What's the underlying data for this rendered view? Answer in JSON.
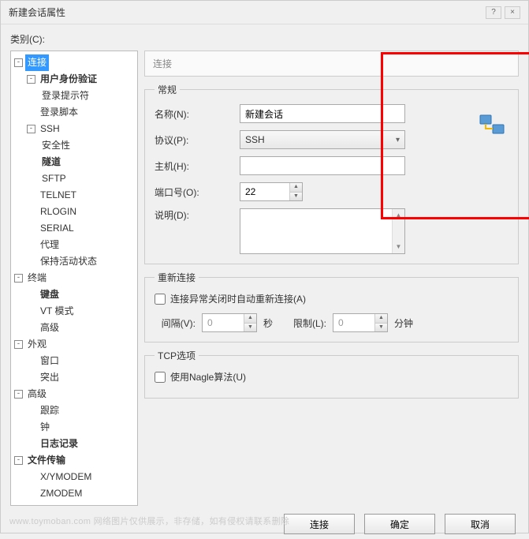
{
  "title": "新建会话属性",
  "category_label": "类别(C):",
  "tree": {
    "connection": {
      "label": "连接",
      "expanded": true,
      "selected": true
    },
    "userauth": {
      "label": "用户身份验证",
      "bold": true,
      "expanded": true
    },
    "loginprompt": {
      "label": "登录提示符"
    },
    "loginscript": {
      "label": "登录脚本"
    },
    "ssh": {
      "label": "SSH",
      "expanded": true
    },
    "security": {
      "label": "安全性"
    },
    "tunnel": {
      "label": "隧道",
      "bold": true
    },
    "sftp": {
      "label": "SFTP"
    },
    "telnet": {
      "label": "TELNET"
    },
    "rlogin": {
      "label": "RLOGIN"
    },
    "serial": {
      "label": "SERIAL"
    },
    "proxy": {
      "label": "代理"
    },
    "keepalive": {
      "label": "保持活动状态"
    },
    "terminal": {
      "label": "终端",
      "expanded": true
    },
    "keyboard": {
      "label": "键盘",
      "bold": true
    },
    "vtmode": {
      "label": "VT 模式"
    },
    "advanced_t": {
      "label": "高级"
    },
    "appearance": {
      "label": "外观",
      "expanded": true
    },
    "window": {
      "label": "窗口"
    },
    "highlight": {
      "label": "突出"
    },
    "advanced": {
      "label": "高级",
      "expanded": true
    },
    "trace": {
      "label": "跟踪"
    },
    "bell": {
      "label": "钟"
    },
    "logging": {
      "label": "日志记录",
      "bold": true
    },
    "filetransfer": {
      "label": "文件传输",
      "expanded": true
    },
    "xymodem": {
      "label": "X/YMODEM"
    },
    "zmodem": {
      "label": "ZMODEM"
    }
  },
  "header_title": "连接",
  "general": {
    "legend": "常规",
    "name_label": "名称(N):",
    "name_value": "新建会话",
    "protocol_label": "协议(P):",
    "protocol_value": "SSH",
    "host_label": "主机(H):",
    "host_value": "",
    "port_label": "端口号(O):",
    "port_value": "22",
    "desc_label": "说明(D):",
    "desc_value": ""
  },
  "reconnect": {
    "legend": "重新连接",
    "auto_label": "连接异常关闭时自动重新连接(A)",
    "auto_checked": false,
    "interval_label": "间隔(V):",
    "interval_value": "0",
    "interval_unit": "秒",
    "limit_label": "限制(L):",
    "limit_value": "0",
    "limit_unit": "分钟"
  },
  "tcp": {
    "legend": "TCP选项",
    "nagle_label": "使用Nagle算法(U)",
    "nagle_checked": false
  },
  "buttons": {
    "connect": "连接",
    "ok": "确定",
    "cancel": "取消"
  },
  "watermark": "www.toymoban.com 网络图片仅供展示，非存储，如有侵权请联系删除"
}
